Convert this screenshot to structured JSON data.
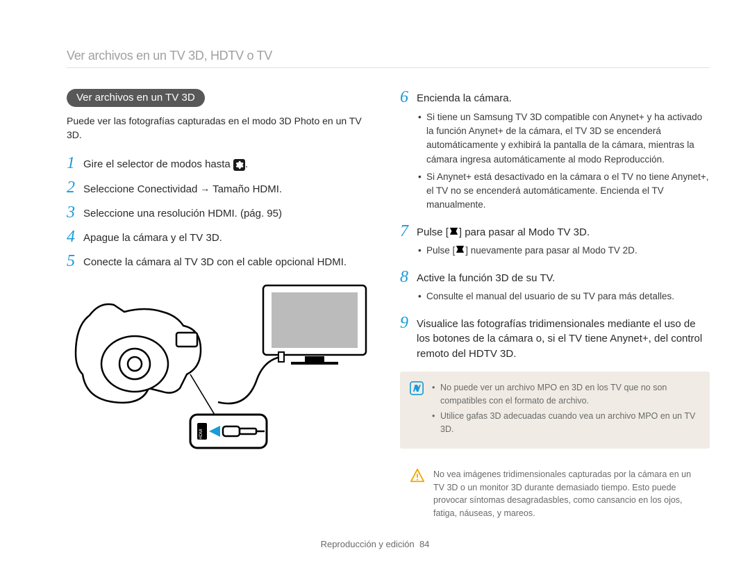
{
  "preTitle": "Ver archivos en un TV 3D, HDTV o TV",
  "section": {
    "heading": "Ver archivos en un TV 3D",
    "intro": "Puede ver las fotografías capturadas en el modo 3D Photo en un TV 3D."
  },
  "steps": {
    "s1": {
      "pre": "Gire el selector de modos hasta ",
      "post": "."
    },
    "s2": {
      "pre": "Seleccione ",
      "b1": "Conectividad",
      "arrow": " → ",
      "b2": "Tamaño HDMI",
      "post": "."
    },
    "s3": "Seleccione una resolución HDMI. (pág. 95)",
    "s4": "Apague la cámara y el TV 3D.",
    "s5": "Conecte la cámara al TV 3D con el cable opcional HDMI.",
    "s6": "Encienda la cámara.",
    "s6b1": "Si tiene un Samsung TV 3D compatible con Anynet+ y ha activado la función Anynet+ de la cámara, el TV 3D se encenderá automáticamente y exhibirá la pantalla de la cámara, mientras la cámara ingresa automáticamente al modo Reproducción.",
    "s6b2": "Si Anynet+ está desactivado en la cámara o el TV no tiene Anynet+, el TV no se encenderá automáticamente. Encienda el TV manualmente.",
    "s7": {
      "pre": "Pulse [",
      "post": "] para pasar al ",
      "b": "Modo TV 3D",
      "end": "."
    },
    "s7b1": {
      "pre": "Pulse [",
      "post": "] nuevamente para pasar al ",
      "b": "Modo TV 2D",
      "end": "."
    },
    "s8": "Active la función 3D de su TV.",
    "s8b1": "Consulte el manual del usuario de su TV para más detalles.",
    "s9": "Visualice las fotografías tridimensionales mediante el uso de los botones de la cámara o, si el TV tiene Anynet+, del control remoto del HDTV 3D."
  },
  "note": {
    "b1": "No puede ver un archivo MPO en 3D en los TV que no son compatibles con el formato de archivo.",
    "b2": "Utilice gafas 3D adecuadas cuando vea un archivo MPO en un TV 3D."
  },
  "warning": "No vea imágenes tridimensionales capturadas por la cámara en un TV 3D o un monitor 3D durante demasiado tiempo. Esto puede provocar síntomas desagradasbles, como cansancio en los ojos, fatiga, náuseas, y mareos.",
  "footer": {
    "section": "Reproducción y edición",
    "page": "84"
  }
}
